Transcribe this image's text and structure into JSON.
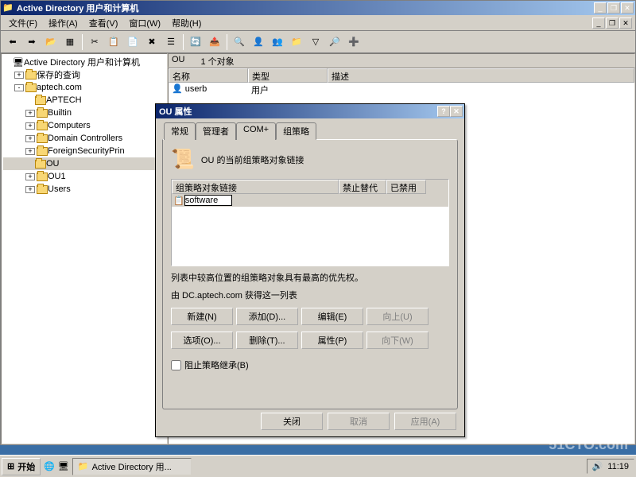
{
  "window": {
    "title": "Active Directory 用户和计算机",
    "menus": [
      "文件(F)",
      "操作(A)",
      "查看(V)",
      "窗口(W)",
      "帮助(H)"
    ]
  },
  "tree": {
    "root": "Active Directory 用户和计算机",
    "items": [
      {
        "label": "保存的查询",
        "exp": "+"
      },
      {
        "label": "aptech.com",
        "exp": "-"
      },
      {
        "label": "APTECH",
        "indent": 2
      },
      {
        "label": "Builtin",
        "exp": "+",
        "indent": 2
      },
      {
        "label": "Computers",
        "exp": "+",
        "indent": 2
      },
      {
        "label": "Domain Controllers",
        "exp": "+",
        "indent": 2
      },
      {
        "label": "ForeignSecurityPrin",
        "exp": "+",
        "indent": 2
      },
      {
        "label": "OU",
        "indent": 2,
        "selected": true
      },
      {
        "label": "OU1",
        "exp": "+",
        "indent": 2
      },
      {
        "label": "Users",
        "exp": "+",
        "indent": 2
      }
    ]
  },
  "pathbar": {
    "name": "OU",
    "count": "1 个对象"
  },
  "list": {
    "headers": [
      "名称",
      "类型",
      "描述"
    ],
    "rows": [
      {
        "name": "userb",
        "type": "用户",
        "desc": ""
      }
    ]
  },
  "dialog": {
    "title": "OU 属性",
    "tabs": [
      "常规",
      "管理者",
      "COM+",
      "组策略"
    ],
    "activeTab": 3,
    "header": "OU 的当前组策略对象链接",
    "gpoHeaders": [
      "组策略对象链接",
      "禁止替代",
      "已禁用"
    ],
    "gpoItem": "software",
    "hint1": "列表中较高位置的组策略对象具有最高的优先权。",
    "hint2": "由 DC.aptech.com 获得这一列表",
    "buttons": {
      "new": "新建(N)",
      "add": "添加(D)...",
      "edit": "编辑(E)",
      "up": "向上(U)",
      "options": "选项(O)...",
      "delete": "删除(T)...",
      "props": "属性(P)",
      "down": "向下(W)"
    },
    "checkbox": "阻止策略继承(B)",
    "bottom": {
      "close": "关闭",
      "cancel": "取消",
      "apply": "应用(A)"
    }
  },
  "taskbar": {
    "start": "开始",
    "task": "Active Directory 用...",
    "time": "11:19"
  },
  "watermark": "51CTO.com"
}
